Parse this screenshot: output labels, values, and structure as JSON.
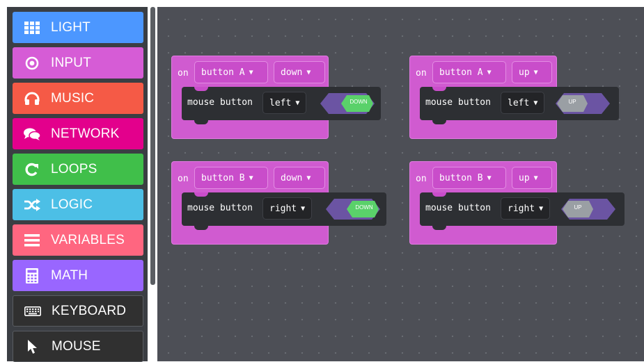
{
  "toolbox": {
    "categories": [
      {
        "label": "LIGHT",
        "icon": "grid-icon",
        "color": "#4c97ff"
      },
      {
        "label": "INPUT",
        "icon": "target-icon",
        "color": "#d65cd6"
      },
      {
        "label": "MUSIC",
        "icon": "headphones-icon",
        "color": "#f55a46"
      },
      {
        "label": "NETWORK",
        "icon": "chat-icon",
        "color": "#e3008c"
      },
      {
        "label": "LOOPS",
        "icon": "loop-icon",
        "color": "#40bf4a"
      },
      {
        "label": "LOGIC",
        "icon": "shuffle-icon",
        "color": "#4cbfe6"
      },
      {
        "label": "VARIABLES",
        "icon": "list-icon",
        "color": "#ff6680"
      },
      {
        "label": "MATH",
        "icon": "calculator-icon",
        "color": "#9966ff"
      },
      {
        "label": "KEYBOARD",
        "icon": "keyboard-icon",
        "color": "#303030"
      },
      {
        "label": "MOUSE",
        "icon": "cursor-icon",
        "color": "#303030"
      }
    ]
  },
  "workspace": {
    "blocks": [
      {
        "on": "on",
        "button": "button A",
        "event": "down",
        "action": "mouse button",
        "which": "left",
        "state": "DOWN"
      },
      {
        "on": "on",
        "button": "button A",
        "event": "up",
        "action": "mouse button",
        "which": "left",
        "state": "UP"
      },
      {
        "on": "on",
        "button": "button B",
        "event": "down",
        "action": "mouse button",
        "which": "right",
        "state": "DOWN"
      },
      {
        "on": "on",
        "button": "button B",
        "event": "up",
        "action": "mouse button",
        "which": "right",
        "state": "UP"
      }
    ]
  },
  "colors": {
    "event_block": "#d05bd0",
    "statement_block": "#2d2f33",
    "down_toggle": "#5ad16a",
    "up_toggle": "#9a9fa4",
    "toggle_track": "#6b54a3"
  }
}
